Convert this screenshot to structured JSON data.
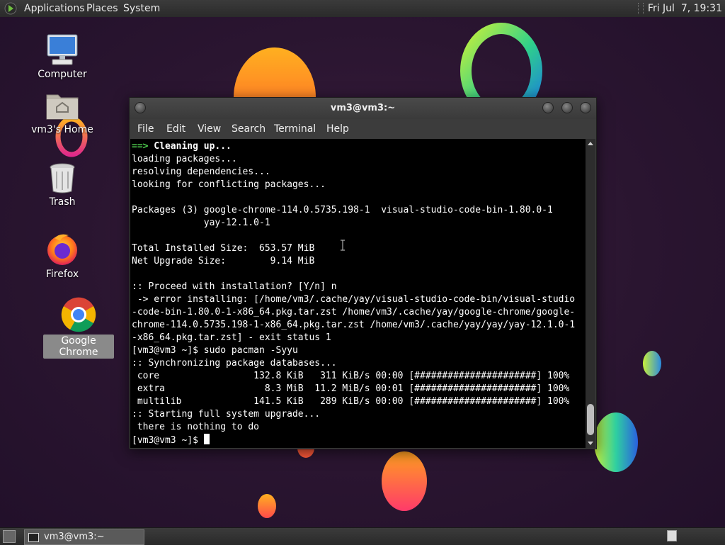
{
  "top_panel": {
    "menus": [
      "Applications",
      "Places",
      "System"
    ],
    "clock": "Fri Jul  7, 19:31"
  },
  "desktop_icons": [
    {
      "label": "Computer",
      "icon": "computer-icon"
    },
    {
      "label": "vm3's Home",
      "icon": "home-folder-icon"
    },
    {
      "label": "Trash",
      "icon": "trash-icon"
    },
    {
      "label": "Firefox",
      "icon": "firefox-icon"
    },
    {
      "label": "Google Chrome",
      "icon": "chrome-icon",
      "selected": true
    }
  ],
  "terminal": {
    "title": "vm3@vm3:~",
    "menu": [
      "File",
      "Edit",
      "View",
      "Search",
      "Terminal",
      "Help"
    ],
    "lines": [
      {
        "prefix": "==>",
        "text": " Cleaning up...",
        "style": "arrow"
      },
      {
        "text": "loading packages..."
      },
      {
        "text": "resolving dependencies..."
      },
      {
        "text": "looking for conflicting packages..."
      },
      {
        "text": ""
      },
      {
        "text": "Packages (3) google-chrome-114.0.5735.198-1  visual-studio-code-bin-1.80.0-1"
      },
      {
        "text": "             yay-12.1.0-1"
      },
      {
        "text": ""
      },
      {
        "text": "Total Installed Size:  653.57 MiB"
      },
      {
        "text": "Net Upgrade Size:        9.14 MiB"
      },
      {
        "text": ""
      },
      {
        "text": ":: Proceed with installation? [Y/n] n"
      },
      {
        "text": " -> error installing: [/home/vm3/.cache/yay/visual-studio-code-bin/visual-studio"
      },
      {
        "text": "-code-bin-1.80.0-1-x86_64.pkg.tar.zst /home/vm3/.cache/yay/google-chrome/google-"
      },
      {
        "text": "chrome-114.0.5735.198-1-x86_64.pkg.tar.zst /home/vm3/.cache/yay/yay/yay-12.1.0-1"
      },
      {
        "text": "-x86_64.pkg.tar.zst] - exit status 1"
      },
      {
        "text": "[vm3@vm3 ~]$ sudo pacman -Syyu"
      },
      {
        "text": ":: Synchronizing package databases..."
      },
      {
        "text": " core                 132.8 KiB   311 KiB/s 00:00 [######################] 100%"
      },
      {
        "text": " extra                  8.3 MiB  11.2 MiB/s 00:01 [######################] 100%"
      },
      {
        "text": " multilib             141.5 KiB   289 KiB/s 00:00 [######################] 100%"
      },
      {
        "text": ":: Starting full system upgrade..."
      },
      {
        "text": " there is nothing to do"
      },
      {
        "text": "[vm3@vm3 ~]$ ",
        "cursor": true
      }
    ]
  },
  "taskbar": {
    "task_label": "vm3@vm3:~"
  }
}
